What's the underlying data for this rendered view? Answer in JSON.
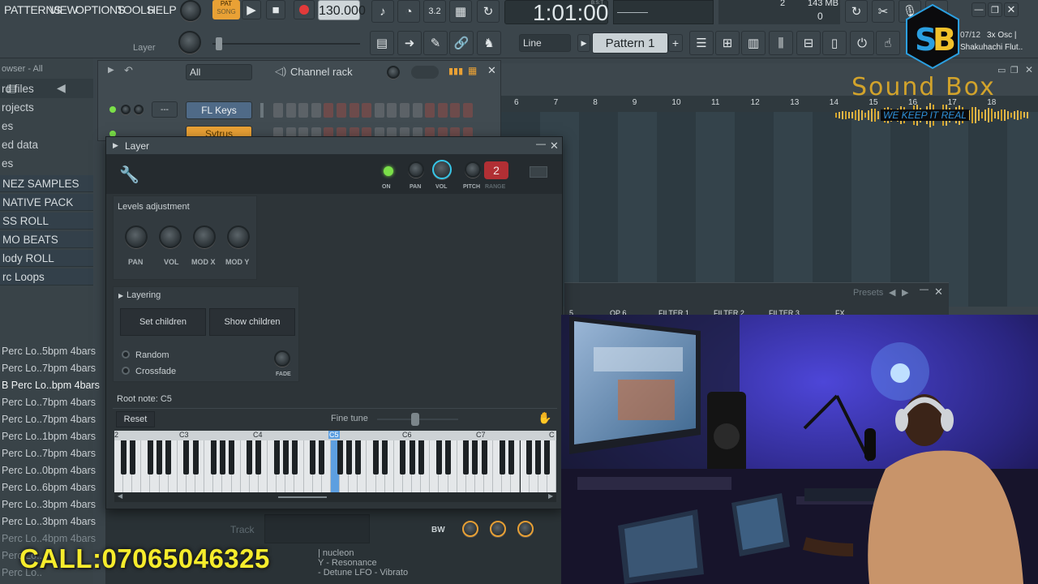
{
  "menu": [
    "PATTERNS",
    "VIEW",
    "OPTIONS",
    "TOOLS",
    "HELP"
  ],
  "transport": {
    "pat_label": "PAT",
    "song_label": "SONG",
    "tempo": "130.000",
    "time": "1:01:00",
    "time_sub": "B:S:T",
    "cpu_top": "2",
    "memory": "143 MB",
    "cpu_bottom": "0"
  },
  "toolbar2": {
    "hint": "Layer",
    "snap": "Line",
    "pattern": "Pattern 1",
    "plugin_hint_line1": "3x Osc |",
    "plugin_hint_line2": "Shakuhachi Flut..",
    "plugin_counter": "07/12"
  },
  "logo": {
    "initials": "SB",
    "name": "Sound Box",
    "tagline": "WE KEEP IT REAL"
  },
  "browser": {
    "header": "owser - All",
    "items": [
      "rd files",
      "rojects",
      "es",
      "ed data",
      "es"
    ],
    "folders": [
      "NEZ SAMPLES",
      "NATIVE PACK",
      "SS ROLL",
      "MO BEATS",
      "lody ROLL",
      "rc Loops"
    ],
    "files": [
      "Perc Lo..5bpm 4bars",
      "Perc Lo..7bpm 4bars",
      "B Perc Lo..bpm 4bars",
      "Perc Lo..7bpm 4bars",
      "Perc Lo..7bpm 4bars",
      "Perc Lo..1bpm 4bars",
      "Perc Lo..7bpm 4bars",
      "Perc Lo..0bpm 4bars",
      "Perc Lo..6bpm 4bars",
      "Perc Lo..3bpm 4bars",
      "Perc Lo..3bpm 4bars",
      "Perc Lo..4bpm 4bars",
      "Perc Lo..",
      "Perc Lo.."
    ]
  },
  "channel_rack": {
    "filter": "All",
    "title": "Channel rack",
    "channel1": "FL Keys",
    "channel2": "Sytrus",
    "dash": "---"
  },
  "playlist": {
    "bar_numbers": [
      "6",
      "7",
      "8",
      "9",
      "10",
      "11",
      "12",
      "13",
      "14",
      "15",
      "16",
      "17",
      "18"
    ]
  },
  "behind_window": {
    "presets": "Presets",
    "tabs": [
      "5",
      "OP 6",
      "FILTER 1",
      "FILTER 2",
      "FILTER 3",
      "FX"
    ],
    "bw": "BW",
    "track": "Track",
    "lines": [
      "| nucleon",
      "Y - Resonance",
      "- Detune  LFO - Vibrato"
    ]
  },
  "layer": {
    "title": "Layer",
    "top_knobs": {
      "on": "ON",
      "pan": "PAN",
      "vol": "VOL",
      "pitch": "PITCH",
      "range": "RANGE",
      "range_value": "2"
    },
    "levels": {
      "title": "Levels adjustment",
      "pan": "PAN",
      "vol": "VOL",
      "modx": "MOD X",
      "mody": "MOD Y"
    },
    "layering": {
      "title": "Layering",
      "set_children": "Set children",
      "show_children": "Show children",
      "random": "Random",
      "crossfade": "Crossfade",
      "fade": "FADE"
    },
    "root_note": "Root note: C5",
    "reset": "Reset",
    "fine_tune": "Fine tune",
    "octaves": [
      "2",
      "C3",
      "C4",
      "C5",
      "C6",
      "C7",
      "C"
    ]
  },
  "overlay": {
    "call": "CALL:07065046325"
  },
  "colors": {
    "accent_orange": "#e9a135",
    "led_green": "#7be049",
    "vol_cyan": "#36c6e8",
    "call_yellow": "#f6ec2c",
    "range_red": "#b12f34",
    "logo_blue": "#2b9fe0",
    "logo_yellow": "#f2c12a"
  }
}
